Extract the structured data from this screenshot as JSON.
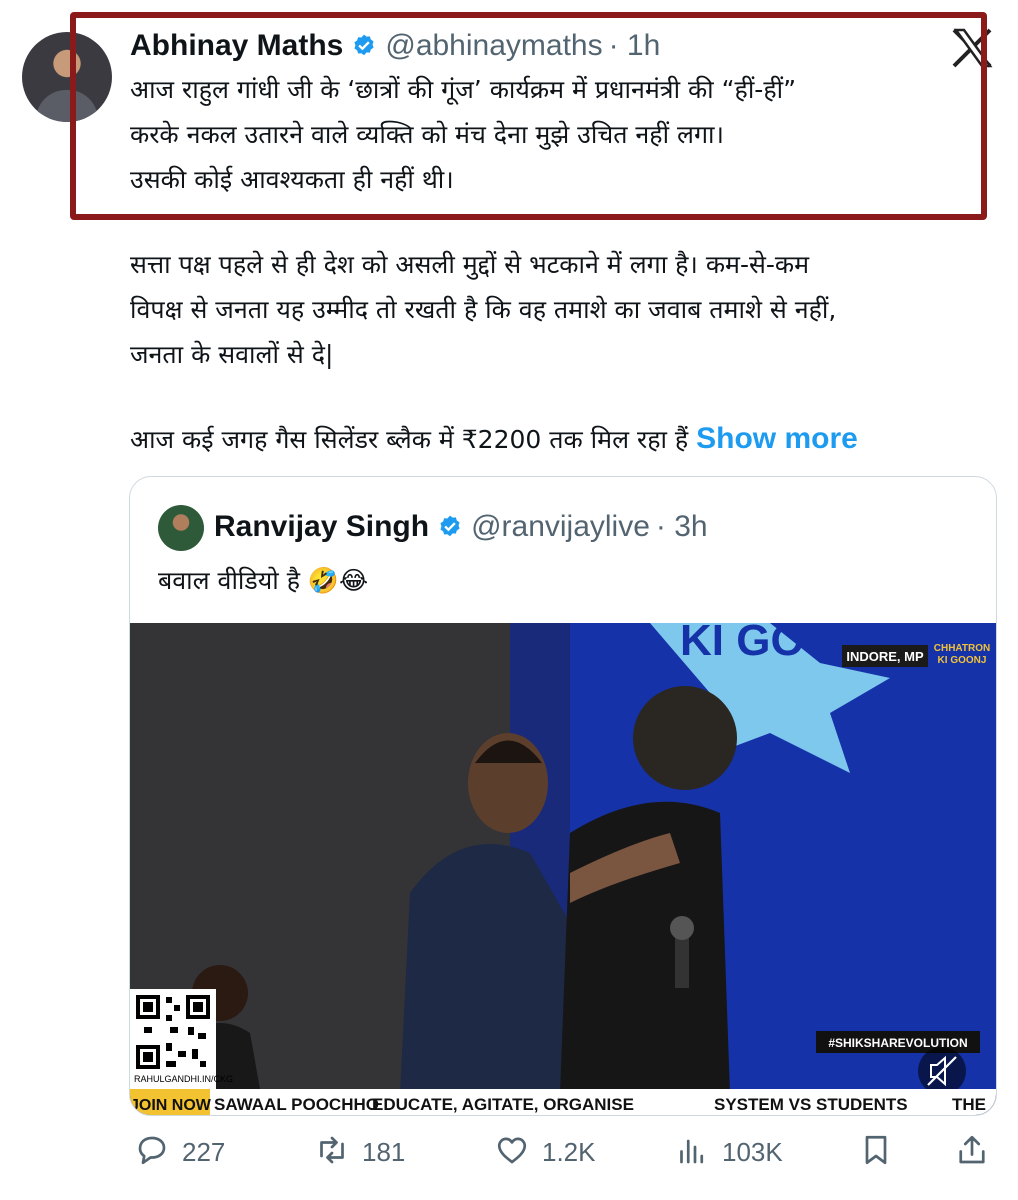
{
  "tweet": {
    "author": {
      "display_name": "Abhinay Maths",
      "verified": true,
      "handle": "@abhinaymaths",
      "time": "· 1h"
    },
    "highlighted_text": [
      "आज राहुल गांधी जी के ‘छात्रों की गूंज’ कार्यक्रम में प्रधानमंत्री की “हीं-हीं”",
      "करके नकल उतारने वाले व्यक्ति को मंच देना मुझे उचित नहीं लगा।",
      "उसकी कोई आवश्यकता ही नहीं थी।"
    ],
    "paragraph2": [
      "सत्ता पक्ष पहले से ही देश को असली मुद्दों से भटकाने में लगा है। कम-से-कम",
      "विपक्ष से जनता यह उम्मीद तो रखती है कि वह तमाशे का जवाब तमाशे से नहीं,",
      "जनता के सवालों से दे|"
    ],
    "paragraph3": "आज कई जगह गैस सिलेंडर ब्लैक में ₹2200 तक मिल रहा हैं",
    "show_more": "Show more"
  },
  "quote": {
    "author": {
      "display_name": "Ranvijay Singh",
      "verified": true,
      "handle": "@ranvijaylive",
      "time": "· 3h"
    },
    "text": "बवाल वीडियो है 🤣😂",
    "video": {
      "location_tag": "INDORE, MP",
      "brand_tag_line1": "CHHATRON",
      "brand_tag_line2": "KI GOONJ",
      "stage_text": "KI GOONJ",
      "hashtag": "#SHIKSHAREVOLUTION",
      "qr_caption": "RAHULGANDHI.IN/CKG",
      "ticker": [
        "JOIN NOW",
        "SAWAAL POOCHHO",
        "EDUCATE, AGITATE, ORGANISE",
        "SYSTEM VS STUDENTS",
        "THE"
      ],
      "muted": true
    }
  },
  "actions": {
    "replies": "227",
    "reposts": "181",
    "likes": "1.2K",
    "views": "103K"
  },
  "colors": {
    "highlight_border": "#8b1a1a",
    "link": "#1d9bf0",
    "verified": "#1d9bf0",
    "muted_text": "#536471",
    "stage_blue": "#1532a8"
  },
  "icons": [
    "verified-icon",
    "x-logo-icon",
    "reply-icon",
    "repost-icon",
    "like-icon",
    "views-icon",
    "bookmark-icon",
    "share-icon",
    "mute-icon",
    "qr-code-icon"
  ]
}
